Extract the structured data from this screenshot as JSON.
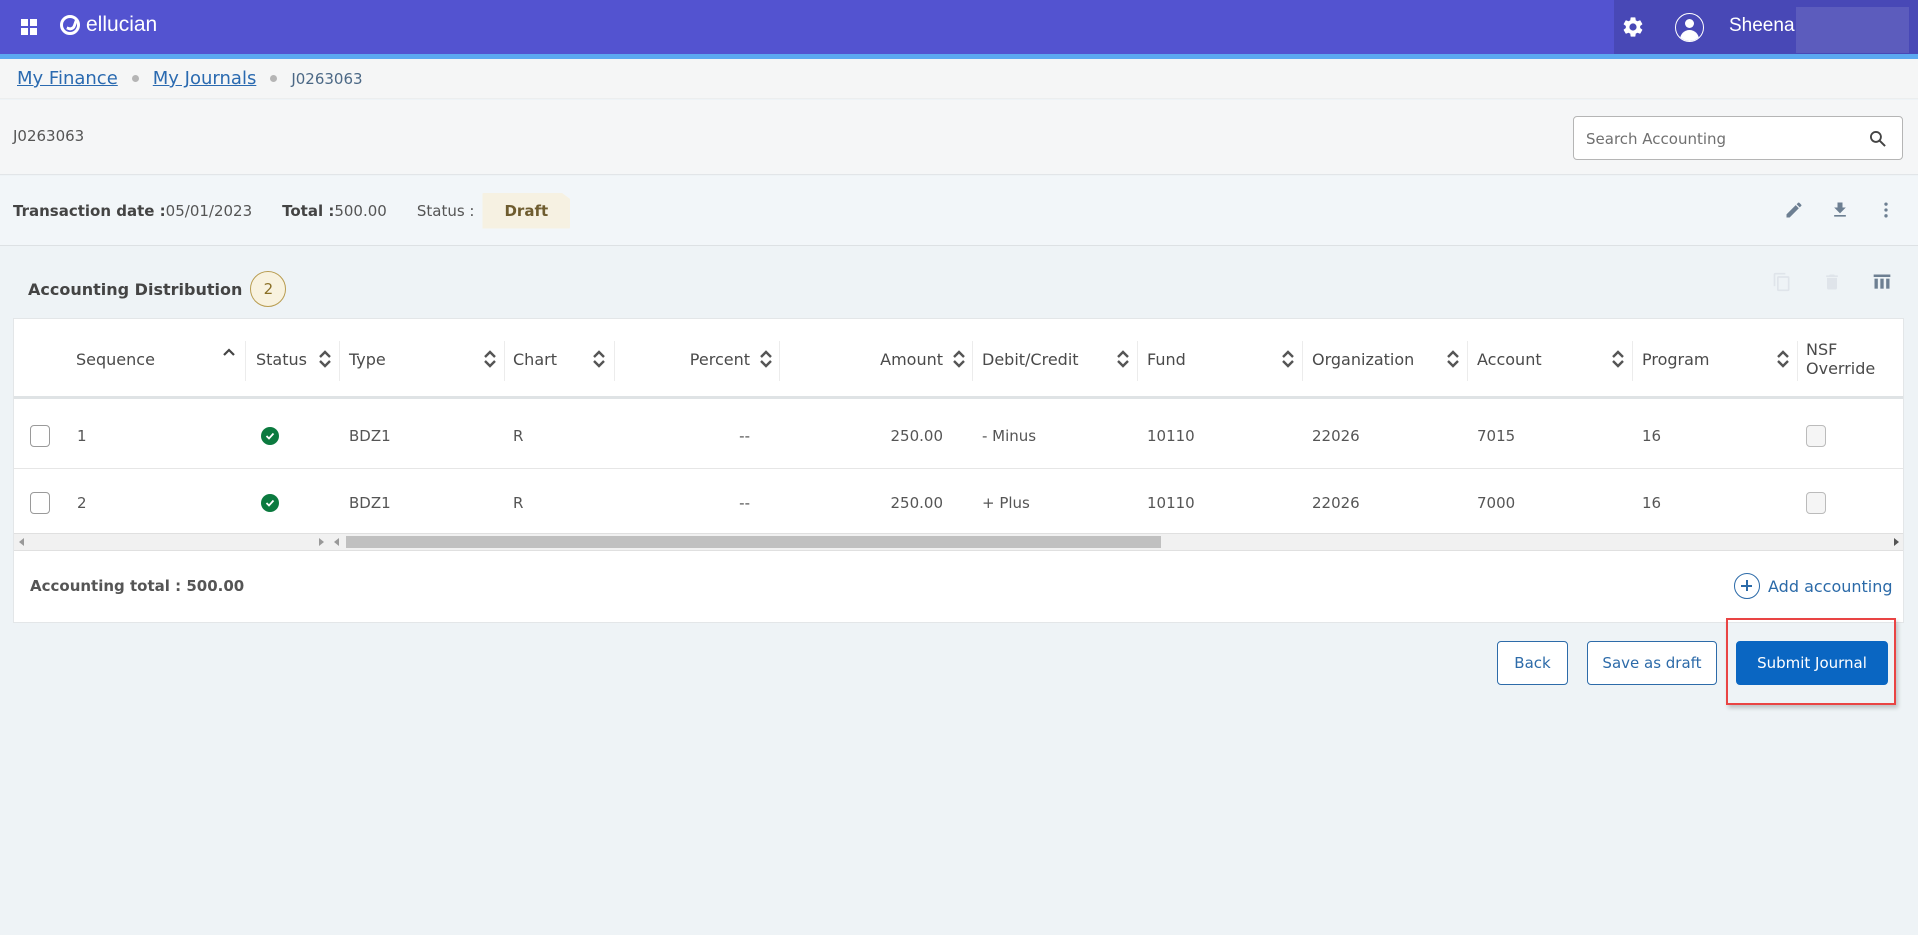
{
  "topbar": {
    "brand": "ellucian",
    "user_name": "Sheena",
    "colors": {
      "bar": "#5353d0",
      "accent_strip": "#5ba8f0"
    },
    "icons": [
      "apps-grid-icon",
      "gear-icon",
      "user-avatar-icon"
    ]
  },
  "breadcrumb": {
    "items": [
      {
        "label": "My Finance",
        "link": true
      },
      {
        "label": "My Journals",
        "link": true
      },
      {
        "label": "J0263063",
        "link": false
      }
    ]
  },
  "header": {
    "journal_id": "J0263063",
    "search": {
      "placeholder": "Search Accounting",
      "value": ""
    }
  },
  "summary": {
    "transaction_date_label": "Transaction date :",
    "transaction_date": "05/01/2023",
    "total_label": "Total :",
    "total": "500.00",
    "status_label": "Status :",
    "status": "Draft",
    "actions": [
      "edit-icon",
      "download-icon",
      "more-vert-icon"
    ]
  },
  "distribution": {
    "title": "Accounting Distribution",
    "count": "2",
    "actions": [
      "copy-icon",
      "delete-icon",
      "columns-icon"
    ],
    "columns": [
      {
        "key": "sequence",
        "label": "Sequence",
        "sort": "asc"
      },
      {
        "key": "status",
        "label": "Status",
        "sort": "none"
      },
      {
        "key": "type",
        "label": "Type",
        "sort": "none"
      },
      {
        "key": "chart",
        "label": "Chart",
        "sort": "none"
      },
      {
        "key": "percent",
        "label": "Percent",
        "sort": "none"
      },
      {
        "key": "amount",
        "label": "Amount",
        "sort": "none"
      },
      {
        "key": "debit_credit",
        "label": "Debit/Credit",
        "sort": "none"
      },
      {
        "key": "fund",
        "label": "Fund",
        "sort": "none"
      },
      {
        "key": "organization",
        "label": "Organization",
        "sort": "none"
      },
      {
        "key": "account",
        "label": "Account",
        "sort": "none"
      },
      {
        "key": "program",
        "label": "Program",
        "sort": "none"
      },
      {
        "key": "nsf_override",
        "label": "NSF Override",
        "sort": "none"
      }
    ],
    "rows": [
      {
        "sequence": "1",
        "status": "valid",
        "type": "BDZ1",
        "chart": "R",
        "percent": "--",
        "amount": "250.00",
        "debit_credit": "- Minus",
        "fund": "10110",
        "organization": "22026",
        "account": "7015",
        "program": "16",
        "nsf_override": false
      },
      {
        "sequence": "2",
        "status": "valid",
        "type": "BDZ1",
        "chart": "R",
        "percent": "--",
        "amount": "250.00",
        "debit_credit": "+ Plus",
        "fund": "10110",
        "organization": "22026",
        "account": "7000",
        "program": "16",
        "nsf_override": false
      }
    ],
    "total_label": "Accounting total : 500.00",
    "add_label": "Add accounting"
  },
  "buttons": {
    "back": "Back",
    "save_draft": "Save as draft",
    "submit": "Submit Journal",
    "primary_color": "#0a66c2"
  }
}
